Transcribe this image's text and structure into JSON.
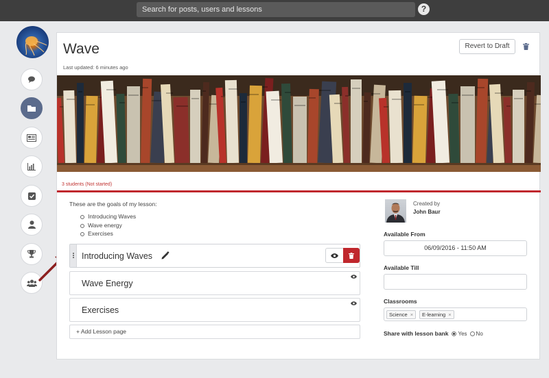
{
  "header": {
    "search_placeholder": "Search for posts, users and lessons",
    "help_label": "?"
  },
  "sidebar": {
    "items": [
      {
        "icon": "comment-icon"
      },
      {
        "icon": "folder-icon",
        "active": true
      },
      {
        "icon": "newspaper-icon"
      },
      {
        "icon": "bar-chart-icon"
      },
      {
        "icon": "checkbox-icon"
      },
      {
        "icon": "user-icon"
      },
      {
        "icon": "trophy-icon"
      },
      {
        "icon": "users-icon"
      }
    ]
  },
  "lesson": {
    "title": "Wave",
    "last_updated": "Last updated: 6 minutes ago",
    "revert_label": "Revert to Draft",
    "students_status": "3 students (Not started)",
    "goals_intro": "These are the goals of my lesson:",
    "goals": [
      "Introducing Waves",
      "Wave energy",
      "Exercises"
    ],
    "pages": [
      {
        "label": "Introducing Waves"
      },
      {
        "label": "Wave Energy"
      },
      {
        "label": "Exercises"
      }
    ],
    "add_page_label": "+ Add Lesson page"
  },
  "details": {
    "created_by_label": "Created by",
    "creator_name": "John Baur",
    "available_from_label": "Available From",
    "available_from_value": "06/09/2016 - 11:50 AM",
    "available_till_label": "Available Till",
    "available_till_value": "",
    "classrooms_label": "Classrooms",
    "classrooms": [
      "Science",
      "E-learning"
    ],
    "share_label": "Share with lesson bank",
    "share_yes": "Yes",
    "share_no": "No",
    "share_selected": "Yes"
  },
  "colors": {
    "topbar": "#3e3e3e",
    "accent_red": "#c0272d",
    "active_rail": "#5b6b8c"
  }
}
